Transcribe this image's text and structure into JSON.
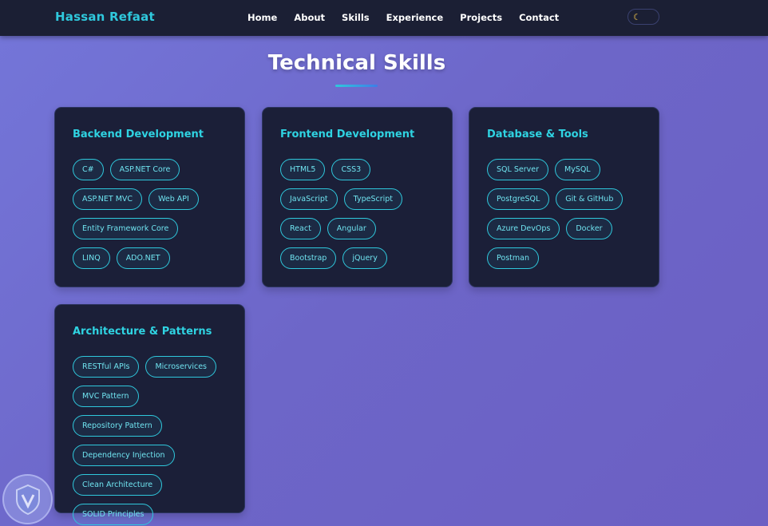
{
  "navbar": {
    "brand": "Hassan Refaat",
    "links": [
      "Home",
      "About",
      "Skills",
      "Experience",
      "Projects",
      "Contact"
    ],
    "theme_toggle_icon": "moon-icon"
  },
  "section": {
    "title": "Technical Skills"
  },
  "cards": [
    {
      "title": "Backend Development",
      "skills": [
        "C#",
        "ASP.NET Core",
        "ASP.NET MVC",
        "Web API",
        "Entity Framework Core",
        "LINQ",
        "ADO.NET"
      ]
    },
    {
      "title": "Frontend Development",
      "skills": [
        "HTML5",
        "CSS3",
        "JavaScript",
        "TypeScript",
        "React",
        "Angular",
        "Bootstrap",
        "jQuery"
      ]
    },
    {
      "title": "Database & Tools",
      "skills": [
        "SQL Server",
        "MySQL",
        "PostgreSQL",
        "Git & GitHub",
        "Azure DevOps",
        "Docker",
        "Postman"
      ]
    },
    {
      "title": "Architecture & Patterns",
      "skills": [
        "RESTful APIs",
        "Microservices",
        "MVC Pattern",
        "Repository Pattern",
        "Dependency Injection",
        "Clean Architecture",
        "SOLID Principles"
      ]
    }
  ],
  "colors": {
    "accent": "#2fc8dc",
    "navbar_bg": "#1b1f34",
    "card_bg": "#1b1f38",
    "page_bg": "#7070d4"
  }
}
